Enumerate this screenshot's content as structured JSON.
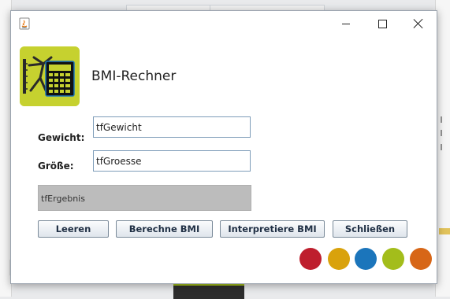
{
  "window": {
    "title": "",
    "app_title": "BMI-Rechner"
  },
  "form": {
    "weight_label": "Gewicht:",
    "weight_value": "tfGewicht",
    "height_label": "Größe:",
    "height_value": "tfGroesse",
    "result_text": "tfErgebnis"
  },
  "buttons": {
    "clear": "Leeren",
    "calculate": "Berechne BMI",
    "interpret": "Interpretiere BMI",
    "close": "Schließen"
  },
  "colors": {
    "logo_bg": "#c6d12f",
    "dots": [
      "#be1e2d",
      "#d9a20c",
      "#1b75bb",
      "#a3bd1b",
      "#d76617"
    ]
  },
  "icons": {
    "window_icon": "java-icon",
    "logo": "calculator-figure-icon"
  }
}
